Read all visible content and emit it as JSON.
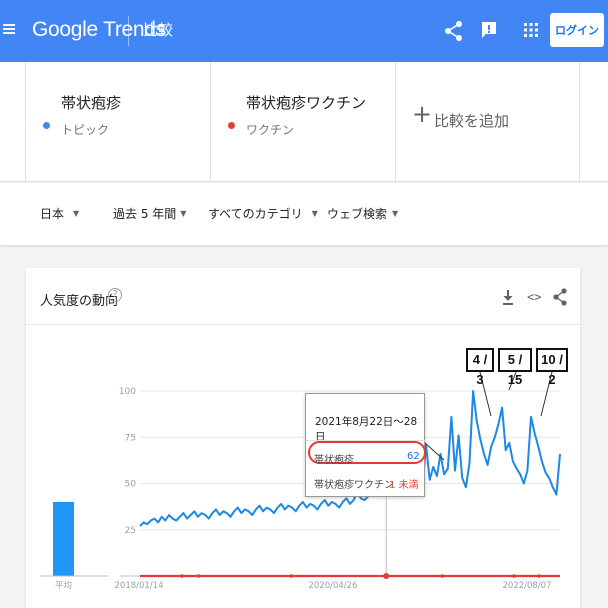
{
  "header": {
    "logo": "Google Trends",
    "title": "比較",
    "login_label": "ログイン"
  },
  "terms": [
    {
      "name": "帯状疱疹",
      "type": "トピック",
      "color": "#4285f4"
    },
    {
      "name": "帯状疱疹ワクチン",
      "type": "ワクチン",
      "color": "#db4437"
    }
  ],
  "add_compare": {
    "plus": "+",
    "label": "比較を追加"
  },
  "filters": [
    {
      "label": "日本"
    },
    {
      "label": "過去 5 年間"
    },
    {
      "label": "すべてのカテゴリ"
    },
    {
      "label": "ウェブ検索"
    }
  ],
  "card": {
    "title": "人気度の動向",
    "help": "?",
    "embed": "<>"
  },
  "tooltip": {
    "date": "2021年8月22日〜28日",
    "rows": [
      {
        "name": "帯状疱疹",
        "value": "62",
        "color": "#1a73e8"
      },
      {
        "name": "帯状疱疹ワクチン",
        "value": "1 未満",
        "color": "#db4437"
      }
    ]
  },
  "callouts": [
    "4 / 3",
    "5 / 15",
    "10 / 2"
  ],
  "chart_data": {
    "type": "line",
    "ylim": [
      0,
      100
    ],
    "y_ticks": [
      "100",
      "75",
      "50",
      "25"
    ],
    "x_tick_labels": [
      "2018/01/14",
      "2020/04/26",
      "2022/08/07"
    ],
    "average_label": "平均",
    "averages": [
      {
        "name": "帯状疱疹",
        "value": 40
      }
    ],
    "series": [
      {
        "name": "帯状疱疹",
        "color": "#1e88e5",
        "values": [
          27,
          29,
          28,
          30,
          31,
          29,
          32,
          30,
          33,
          31,
          30,
          32,
          34,
          31,
          33,
          35,
          32,
          34,
          33,
          31,
          34,
          36,
          33,
          35,
          34,
          32,
          35,
          37,
          34,
          36,
          35,
          33,
          36,
          38,
          35,
          37,
          36,
          34,
          37,
          39,
          36,
          38,
          37,
          35,
          38,
          40,
          37,
          39,
          38,
          36,
          39,
          41,
          38,
          40,
          39,
          37,
          40,
          42,
          39,
          41,
          45,
          42,
          41,
          43,
          46,
          44,
          47,
          50,
          62,
          48,
          46,
          49,
          52,
          55,
          51,
          56,
          53,
          58,
          47,
          71,
          52,
          59,
          54,
          66,
          55,
          58,
          86,
          57,
          76,
          53,
          48,
          61,
          100,
          84,
          74,
          66,
          60,
          70,
          75,
          82,
          91,
          68,
          72,
          62,
          58,
          55,
          50,
          57,
          86,
          77,
          70,
          62,
          56,
          53,
          48,
          44,
          66
        ]
      },
      {
        "name": "帯状疱疹ワクチン",
        "color": "#e53935",
        "values": [
          0,
          0,
          0,
          0,
          0,
          0,
          0,
          0,
          0,
          0,
          0,
          0,
          0,
          0,
          0,
          0,
          0,
          0,
          0,
          0,
          0,
          0,
          0,
          0,
          0,
          0,
          0,
          0,
          0,
          0,
          0,
          0,
          0,
          0,
          0,
          0,
          0,
          0,
          0,
          0,
          0,
          0,
          0,
          0,
          0,
          0,
          0,
          0,
          0,
          0,
          0,
          0,
          0,
          0,
          0,
          0,
          0,
          0,
          0,
          0,
          0,
          0,
          0,
          0,
          0,
          0,
          0,
          0,
          0,
          0,
          0,
          0,
          0,
          0,
          0,
          0,
          0,
          0,
          0,
          0,
          0,
          0,
          0,
          0,
          0,
          0,
          0,
          0,
          0,
          0,
          0,
          0,
          0,
          0,
          0,
          0,
          0,
          0,
          0,
          0,
          0,
          0,
          0,
          0,
          0,
          0,
          0,
          0,
          0,
          0,
          0,
          0,
          0,
          0,
          0,
          0,
          0
        ]
      }
    ]
  }
}
